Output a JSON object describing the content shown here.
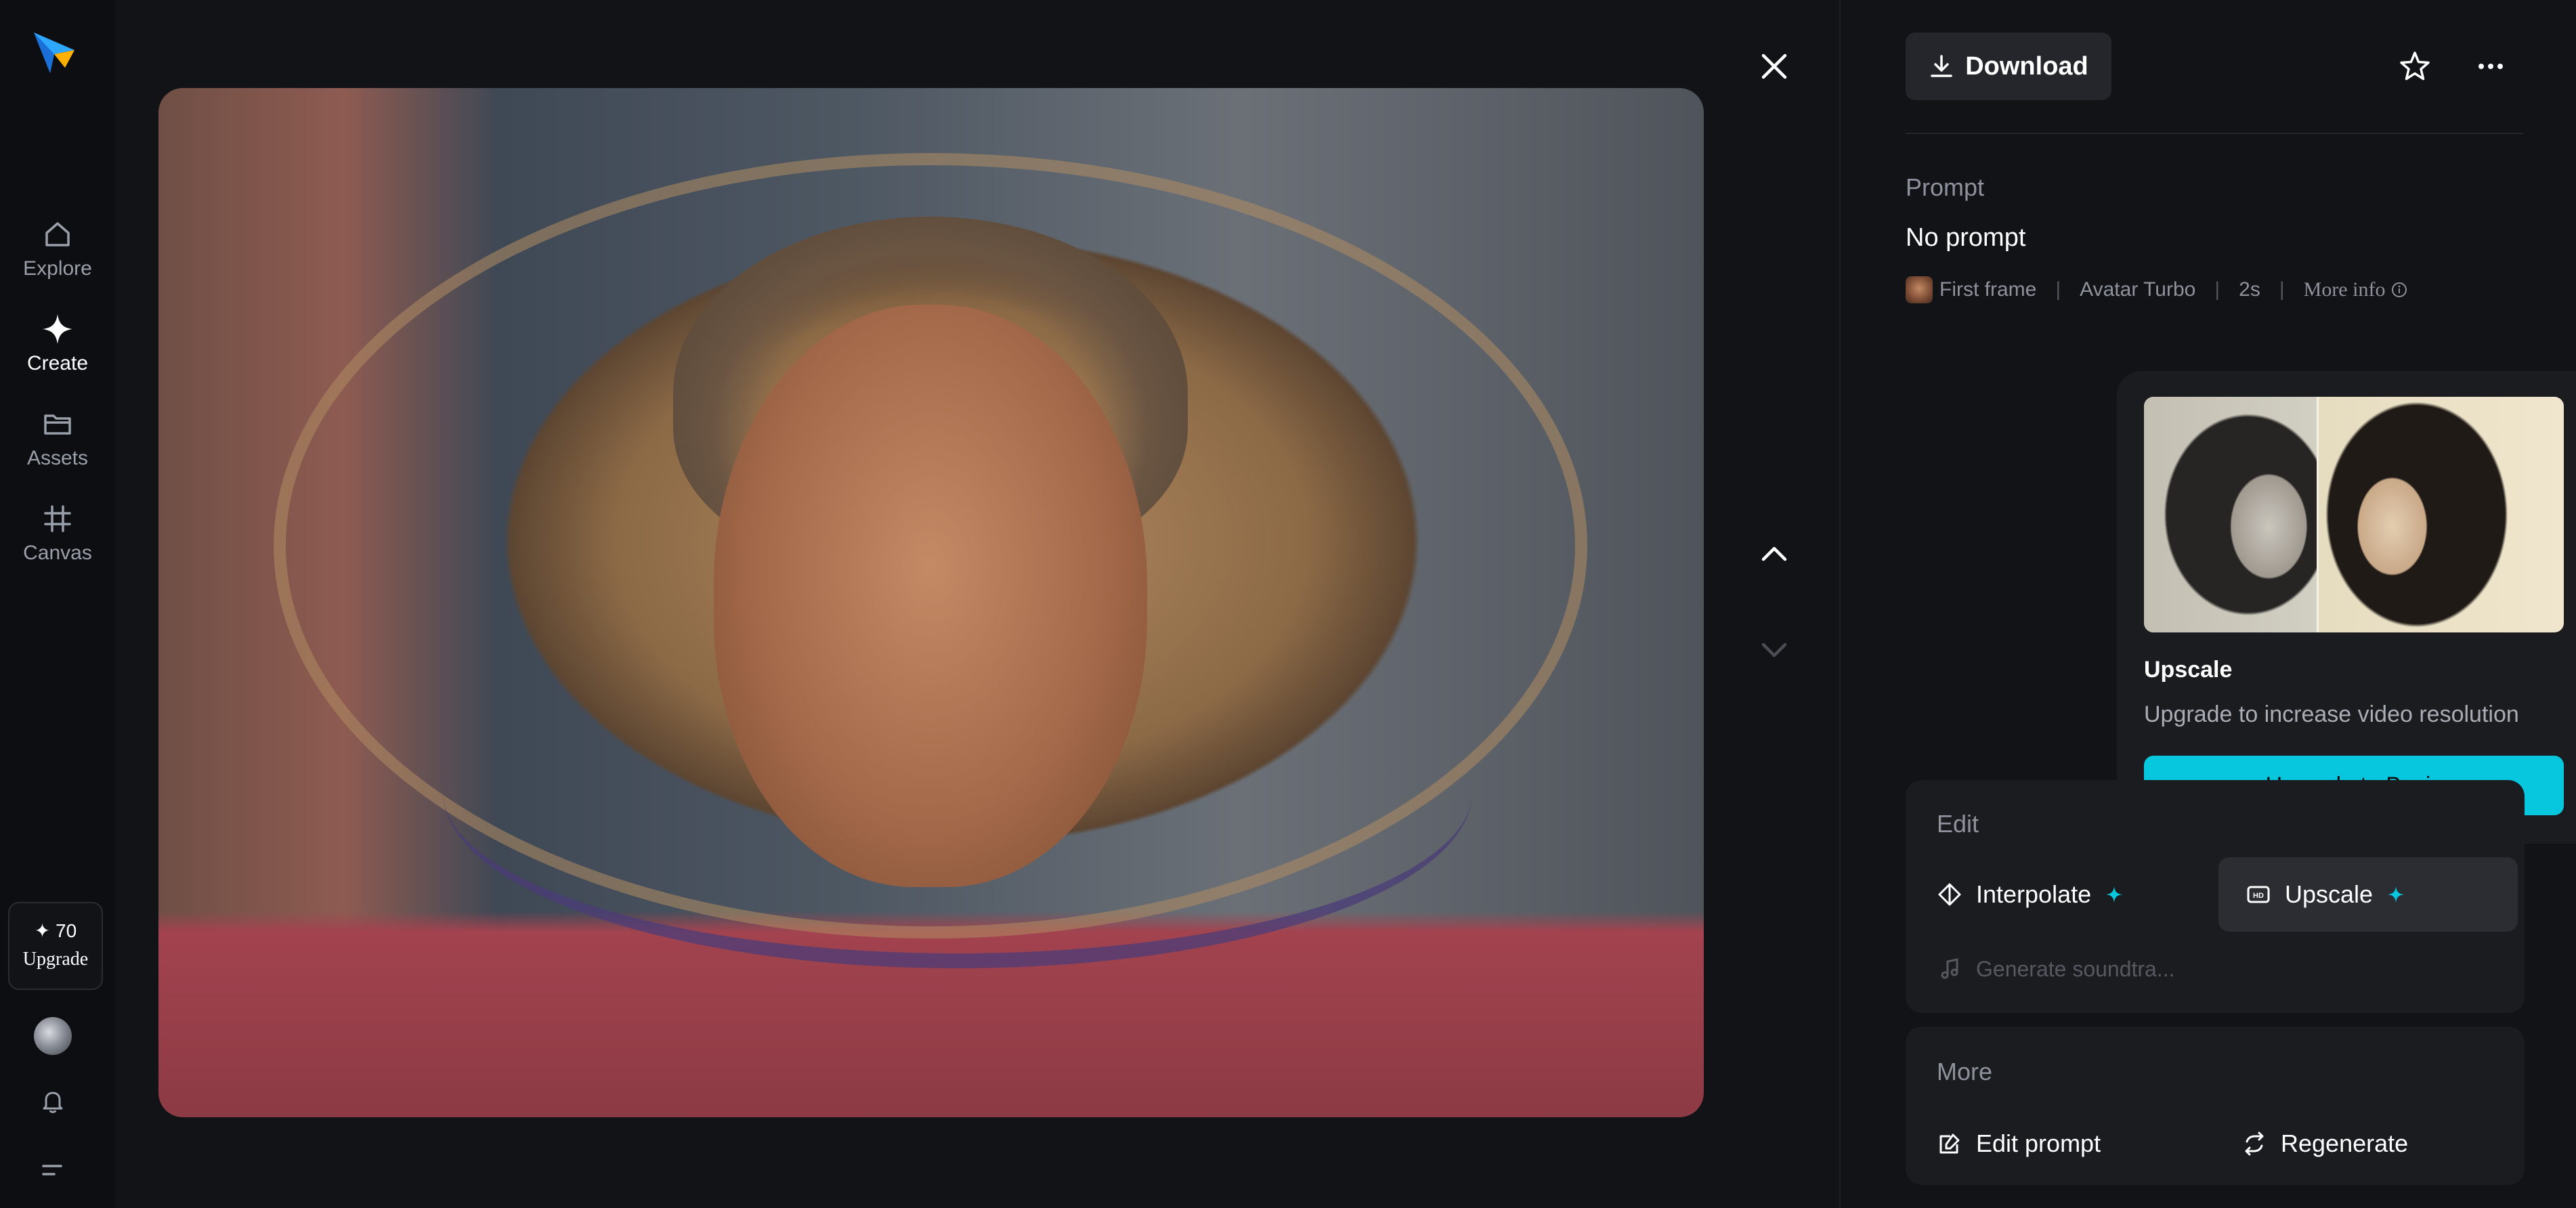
{
  "nav": {
    "items": [
      {
        "label": "Explore",
        "icon": "home-icon"
      },
      {
        "label": "Create",
        "icon": "create-diamond-icon"
      },
      {
        "label": "Assets",
        "icon": "folder-icon"
      },
      {
        "label": "Canvas",
        "icon": "canvas-grid-icon"
      }
    ],
    "active": "Create",
    "credits": "✦ 70",
    "upgrade_label": "Upgrade"
  },
  "viewer": {
    "image_desc_icon": "close-icon"
  },
  "panel": {
    "download_label": "Download",
    "prompt_label": "Prompt",
    "prompt_value": "No prompt",
    "meta": {
      "first_frame": "First frame",
      "model": "Avatar Turbo",
      "duration": "2s",
      "more_info": "More info"
    }
  },
  "popup": {
    "title": "Upscale",
    "description": "Upgrade to increase video resolution",
    "cta": "Upgrade to Basic"
  },
  "edit": {
    "heading": "Edit",
    "interpolate": "Interpolate",
    "upscale": "Upscale",
    "soundtrack": "Generate soundtra..."
  },
  "more": {
    "heading": "More",
    "edit_prompt": "Edit prompt",
    "regenerate": "Regenerate"
  },
  "colors": {
    "accent": "#06c7de",
    "background": "#121316",
    "card": "#1b1c20"
  }
}
